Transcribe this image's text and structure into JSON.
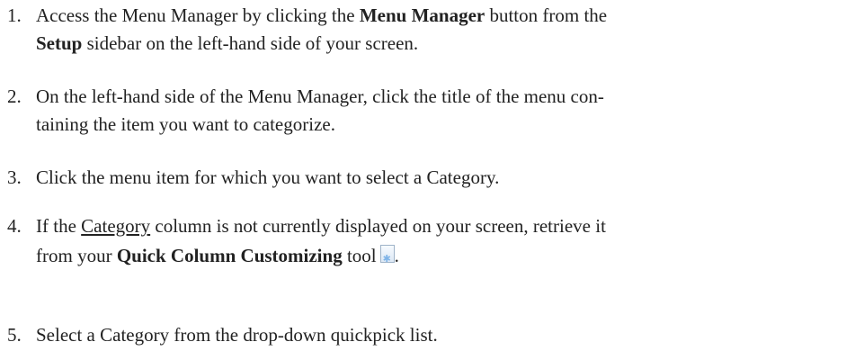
{
  "steps": [
    {
      "number": "1.",
      "line1_a": "Access the Menu Manager by clicking the ",
      "line1_b": "Menu Manager",
      "line1_c": " button from the",
      "line2_a": "Setup",
      "line2_b": " sidebar on the left-hand side of your screen."
    },
    {
      "number": "2.",
      "line1": "On the left-hand side of the Menu Manager, click the title of the menu con-",
      "line2": "taining the item you want to categorize."
    },
    {
      "number": "3.",
      "line1": "Click the menu item for which you want to select a Category."
    },
    {
      "number": "4.",
      "line1_a": "If the ",
      "line1_b": "Category",
      "line1_c": " column is not currently displayed on your screen, retrieve it",
      "line2_a": "from your ",
      "line2_b": "Quick Column Customizing",
      "line2_c": " tool",
      "line2_d": "."
    },
    {
      "number": "5.",
      "line1": "Select a Category from the drop-down quickpick list."
    }
  ]
}
